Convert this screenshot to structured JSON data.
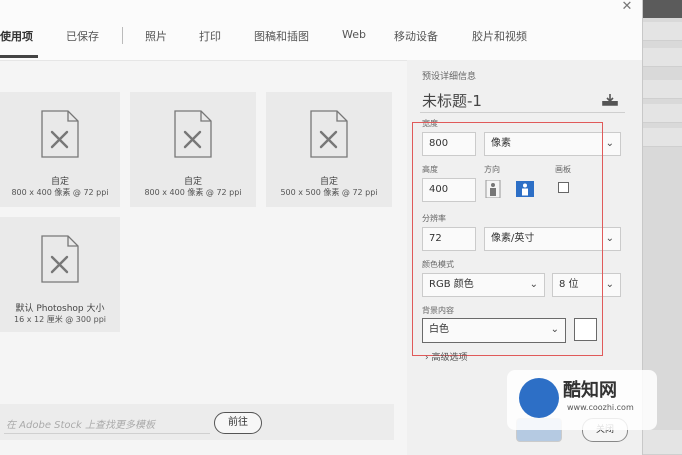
{
  "tabs": [
    {
      "label": "使用项",
      "active": true
    },
    {
      "label": "已保存"
    },
    {
      "label": "照片"
    },
    {
      "label": "打印"
    },
    {
      "label": "图稿和插图"
    },
    {
      "label": "Web"
    },
    {
      "label": "移动设备"
    },
    {
      "label": "胶片和视频"
    }
  ],
  "presets": [
    {
      "name": "自定",
      "size": "800 x 400 像素 @ 72 ppi"
    },
    {
      "name": "自定",
      "size": "800 x 400 像素 @ 72 ppi"
    },
    {
      "name": "自定",
      "size": "500 x 500 像素 @ 72 ppi"
    },
    {
      "name": "默认 Photoshop 大小",
      "size": "16 x 12 厘米 @ 300 ppi"
    }
  ],
  "stock": {
    "placeholder": "在 Adobe Stock 上查找更多模板",
    "go_label": "前往"
  },
  "details": {
    "header": "预设详细信息",
    "doc_name": "未标题-1",
    "width_label": "宽度",
    "width_value": "800",
    "width_unit": "像素",
    "height_label": "高度",
    "height_value": "400",
    "orientation_label": "方向",
    "artboard_label": "画板",
    "resolution_label": "分辨率",
    "resolution_value": "72",
    "resolution_unit": "像素/英寸",
    "color_mode_label": "颜色模式",
    "color_mode_value": "RGB 颜色",
    "bit_depth": "8 位",
    "background_label": "背景内容",
    "background_value": "白色",
    "advanced_label": "高级选项"
  },
  "footer": {
    "close_label": "关闭"
  },
  "watermark": {
    "title": "酷知网",
    "url": "www.coozhi.com"
  },
  "colors": {
    "accent": "#2d6fc6",
    "highlight_border": "#e05a5a"
  }
}
